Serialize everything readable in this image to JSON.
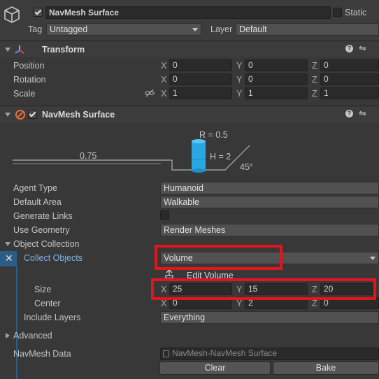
{
  "header": {
    "name": "NavMesh Surface",
    "static_label": "Static",
    "tag_label": "Tag",
    "tag_value": "Untagged",
    "layer_label": "Layer",
    "layer_value": "Default"
  },
  "transform": {
    "title": "Transform",
    "position_label": "Position",
    "rotation_label": "Rotation",
    "scale_label": "Scale",
    "position": {
      "x": "0",
      "y": "0",
      "z": "0"
    },
    "rotation": {
      "x": "0",
      "y": "0",
      "z": "0"
    },
    "scale": {
      "x": "1",
      "y": "1",
      "z": "1"
    }
  },
  "axes": {
    "x": "X",
    "y": "Y",
    "z": "Z"
  },
  "navmesh": {
    "title": "NavMesh Surface",
    "diagram": {
      "radius": "R = 0.5",
      "height": "H = 2",
      "step": "0.75",
      "slope": "45°"
    },
    "agent_type_label": "Agent Type",
    "agent_type": "Humanoid",
    "default_area_label": "Default Area",
    "default_area": "Walkable",
    "generate_links_label": "Generate Links",
    "use_geometry_label": "Use Geometry",
    "use_geometry": "Render Meshes",
    "object_collection_label": "Object Collection",
    "collect_objects_label": "Collect Objects",
    "collect_objects": "Volume",
    "edit_volume_label": "Edit Volume",
    "size_label": "Size",
    "size": {
      "x": "25",
      "y": "15",
      "z": "20"
    },
    "center_label": "Center",
    "center": {
      "x": "0",
      "y": "2",
      "z": "0"
    },
    "include_layers_label": "Include Layers",
    "include_layers": "Everything",
    "advanced_label": "Advanced",
    "navmesh_data_label": "NavMesh Data",
    "navmesh_data": "NavMesh-NavMesh Surface",
    "clear_label": "Clear",
    "bake_label": "Bake"
  },
  "colors": {
    "highlight": "#e3141c",
    "background": "#383838",
    "field": "#2a2a2a"
  }
}
